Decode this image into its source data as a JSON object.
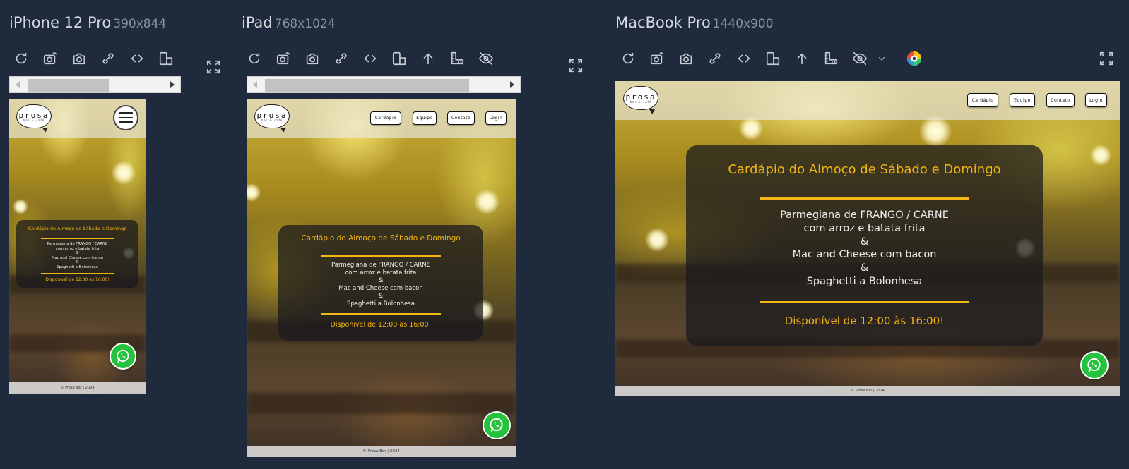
{
  "devices": [
    {
      "name": "iPhone 12 Pro",
      "resolution": "390x844"
    },
    {
      "name": "iPad",
      "resolution": "768x1024"
    },
    {
      "name": "MacBook Pro",
      "resolution": "1440x900"
    }
  ],
  "icons": {
    "reload": "reload-icon",
    "screenshot_auto": "camera-refresh-icon",
    "screenshot": "camera-icon",
    "link": "link-icon",
    "code": "code-icon",
    "rotate": "rotate-device-icon",
    "scroll_top": "arrow-up-icon",
    "ruler": "ruler-icon",
    "hide": "eye-off-icon",
    "dropdown": "chevron-down-icon",
    "color": "color-wheel-icon",
    "fullscreen": "fullscreen-icon",
    "whatsapp": "whatsapp-icon"
  },
  "colors": {
    "accent": "#f3b514",
    "page_bg": "#1f2a3c",
    "whatsapp": "#25c23e"
  },
  "site": {
    "logo_text": "prosa",
    "logo_subtext": "bar & café",
    "nav": [
      "Cardápio",
      "Equipe",
      "Contato",
      "Login"
    ],
    "menu": {
      "title": "Cardápio do Almoço de Sábado e Domingo",
      "dish1_line1": "Parmegiana de FRANGO / CARNE",
      "dish1_line2": "com arroz e batata frita",
      "amp": "&",
      "dish2": "Mac and Cheese com bacon",
      "dish3": "Spaghetti a Bolonhesa",
      "availability": "Disponível de 12:00 às 16:00!"
    },
    "footer": "© Prosa Bar | 2024"
  }
}
